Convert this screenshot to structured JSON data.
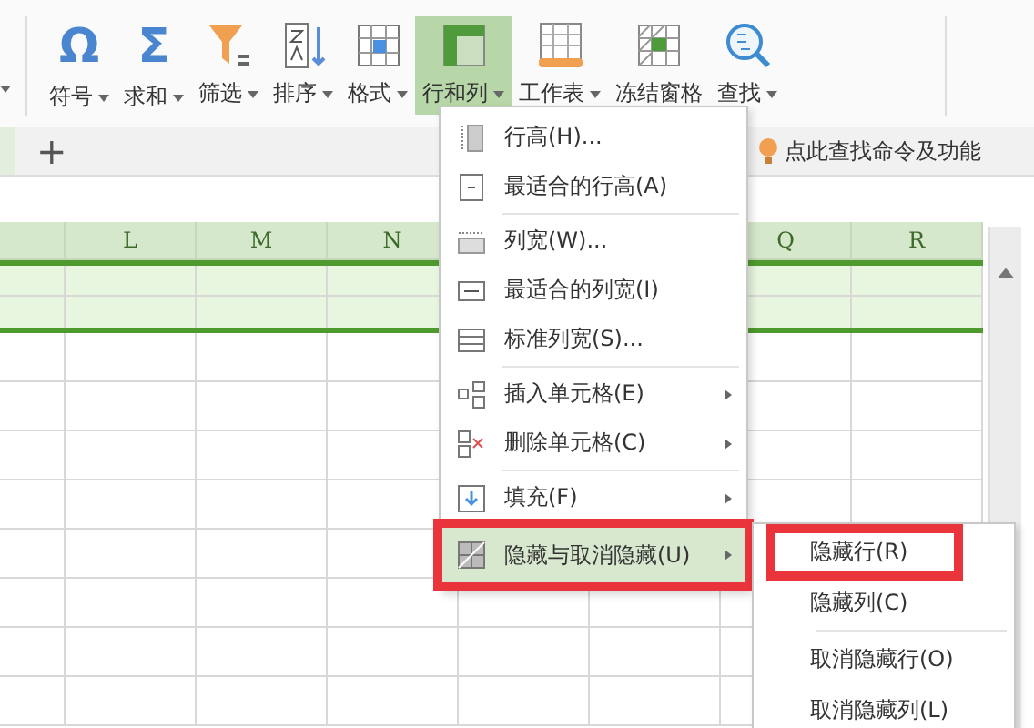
{
  "toolbar": {
    "buttons": [
      {
        "label": "符号",
        "glyph": "Ω",
        "kind": "glyph",
        "has_menu": true,
        "selected": false
      },
      {
        "label": "求和",
        "glyph": "Σ",
        "kind": "glyph",
        "has_menu": true,
        "selected": false
      },
      {
        "label": "筛选",
        "kind": "funnel",
        "has_menu": true,
        "selected": false
      },
      {
        "label": "排序",
        "kind": "sort",
        "has_menu": true,
        "selected": false
      },
      {
        "label": "格式",
        "kind": "format",
        "has_menu": true,
        "selected": false
      },
      {
        "label": "行和列",
        "kind": "rowcol",
        "has_menu": true,
        "selected": true
      },
      {
        "label": "工作表",
        "kind": "sheet",
        "has_menu": true,
        "selected": false
      },
      {
        "label": "冻结窗格",
        "kind": "freeze",
        "has_menu": false,
        "selected": false
      },
      {
        "label": "查找",
        "kind": "find",
        "has_menu": true,
        "selected": false
      }
    ]
  },
  "tab_bar": {
    "add_glyph": "+",
    "hint": "点此查找命令及功能"
  },
  "sheet": {
    "columns": [
      "L",
      "M",
      "N",
      "Q",
      "R"
    ],
    "rows": [
      {
        "selected": true
      },
      {
        "selected": true
      },
      {
        "selected": false
      },
      {
        "selected": false
      },
      {
        "selected": false
      },
      {
        "selected": false
      },
      {
        "selected": false
      },
      {
        "selected": false
      },
      {
        "selected": false
      },
      {
        "selected": false
      }
    ]
  },
  "menu": {
    "items": [
      {
        "label": "行高(H)...",
        "has_submenu": false,
        "separator_before": false,
        "selected": false,
        "highlighted": false
      },
      {
        "label": "最适合的行高(A)",
        "has_submenu": false,
        "separator_before": false,
        "selected": false,
        "highlighted": false
      },
      {
        "label": "列宽(W)...",
        "has_submenu": false,
        "separator_before": true,
        "selected": false,
        "highlighted": false
      },
      {
        "label": "最适合的列宽(I)",
        "has_submenu": false,
        "separator_before": false,
        "selected": false,
        "highlighted": false
      },
      {
        "label": "标准列宽(S)...",
        "has_submenu": false,
        "separator_before": false,
        "selected": false,
        "highlighted": false
      },
      {
        "label": "插入单元格(E)",
        "has_submenu": true,
        "separator_before": true,
        "selected": false,
        "highlighted": false
      },
      {
        "label": "删除单元格(C)",
        "has_submenu": true,
        "separator_before": false,
        "selected": false,
        "highlighted": false
      },
      {
        "label": "填充(F)",
        "has_submenu": true,
        "separator_before": true,
        "selected": false,
        "highlighted": false
      },
      {
        "label": "隐藏与取消隐藏(U)",
        "has_submenu": true,
        "separator_before": false,
        "selected": true,
        "highlighted": true
      }
    ]
  },
  "submenu": {
    "items": [
      {
        "label": "隐藏行(R)",
        "separator_before": false,
        "highlighted": true
      },
      {
        "label": "隐藏列(C)",
        "separator_before": false,
        "highlighted": false
      },
      {
        "label": "取消隐藏行(O)",
        "separator_before": true,
        "highlighted": false
      },
      {
        "label": "取消隐藏列(L)",
        "separator_before": false,
        "highlighted": false
      }
    ]
  }
}
